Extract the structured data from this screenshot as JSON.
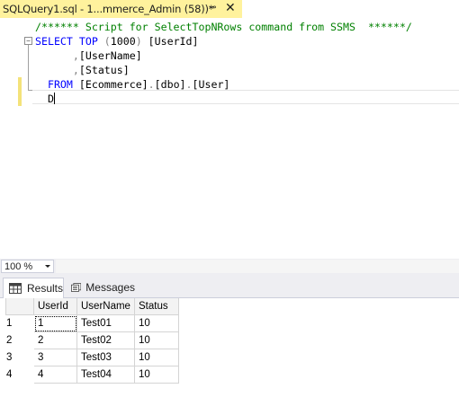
{
  "tab": {
    "title": "SQLQuery1.sql - 1...mmerce_Admin (58))*",
    "pin_glyph": "⊸",
    "close_glyph": "✕"
  },
  "editor": {
    "fold_glyph": "−",
    "lines": [
      {
        "segments": [
          {
            "text": "/****** Script for SelectTopNRows command from SSMS  ******/",
            "cls": "cmt"
          }
        ]
      },
      {
        "segments": [
          {
            "text": "SELECT TOP ",
            "cls": "kw"
          },
          {
            "text": "(",
            "cls": "op"
          },
          {
            "text": "1000",
            "cls": ""
          },
          {
            "text": ")",
            "cls": "op"
          },
          {
            "text": " [UserId]",
            "cls": ""
          }
        ]
      },
      {
        "segments": [
          {
            "text": "      ",
            "cls": ""
          },
          {
            "text": ",",
            "cls": "op"
          },
          {
            "text": "[UserName]",
            "cls": ""
          }
        ]
      },
      {
        "segments": [
          {
            "text": "      ",
            "cls": ""
          },
          {
            "text": ",",
            "cls": "op"
          },
          {
            "text": "[Status]",
            "cls": ""
          }
        ]
      },
      {
        "segments": [
          {
            "text": "  FROM ",
            "cls": "kw"
          },
          {
            "text": "[Ecommerce]",
            "cls": ""
          },
          {
            "text": ".",
            "cls": "op"
          },
          {
            "text": "[dbo]",
            "cls": ""
          },
          {
            "text": ".",
            "cls": "op"
          },
          {
            "text": "[User]",
            "cls": ""
          }
        ]
      },
      {
        "segments": [
          {
            "text": "  D",
            "cls": ""
          }
        ]
      }
    ]
  },
  "zoom": {
    "value": "100 %"
  },
  "results": {
    "tabs": [
      {
        "label": "Results",
        "icon": "grid-icon"
      },
      {
        "label": "Messages",
        "icon": "messages-icon"
      }
    ],
    "columns": [
      "UserId",
      "UserName",
      "Status"
    ],
    "rows": [
      {
        "num": "1",
        "cells": [
          "1",
          "Test01",
          "10"
        ]
      },
      {
        "num": "2",
        "cells": [
          "2",
          "Test02",
          "10"
        ]
      },
      {
        "num": "3",
        "cells": [
          "3",
          "Test03",
          "10"
        ]
      },
      {
        "num": "4",
        "cells": [
          "4",
          "Test04",
          "10"
        ]
      }
    ]
  },
  "colors": {
    "tab_active": "#fff29d",
    "keyword": "#0000ff",
    "comment": "#008000",
    "operator": "#808080"
  }
}
